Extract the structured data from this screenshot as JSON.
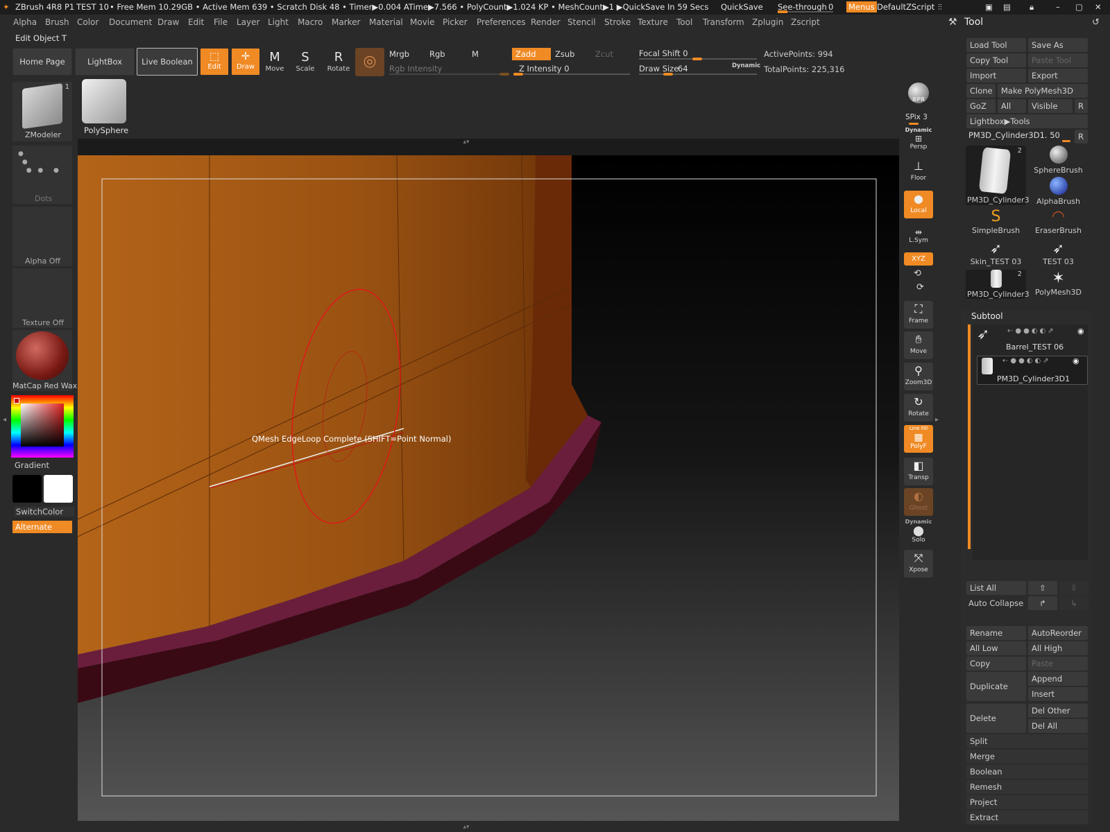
{
  "titlebar": {
    "app": "ZBrush 4R8 P1",
    "doc": "TEST 10",
    "stats": "• Free Mem 10.29GB • Active Mem 639 • Scratch Disk 48 • Timer▶0.004 ATime▶7.566 • PolyCount▶1.024 KP • MeshCount▶1 ▶QuickSave In 59 Secs",
    "quicksave": "QuickSave",
    "seethrough": "See-through",
    "seethrough_val": "0",
    "menus": "Menus",
    "defaultzscript": "DefaultZScript"
  },
  "menubar": [
    "Alpha",
    "Brush",
    "Color",
    "Document",
    "Draw",
    "Edit",
    "File",
    "Layer",
    "Light",
    "Macro",
    "Marker",
    "Material",
    "Movie",
    "Picker",
    "Preferences",
    "Render",
    "Stencil",
    "Stroke",
    "Texture",
    "Tool",
    "Transform",
    "Zplugin",
    "Zscript"
  ],
  "edit_object": "Edit Object T",
  "toolbar": {
    "home_page": "Home Page",
    "lightbox": "LightBox",
    "live_boolean": "Live Boolean",
    "edit": "Edit",
    "draw": "Draw",
    "move": "Move",
    "scale": "Scale",
    "rotate": "Rotate",
    "mrgb": "Mrgb",
    "rgb": "Rgb",
    "m": "M",
    "zadd": "Zadd",
    "zsub": "Zsub",
    "zcut": "Zcut",
    "rgb_intensity": "Rgb Intensity",
    "z_intensity": "Z Intensity 0",
    "focal_shift": "Focal Shift 0",
    "draw_size": "Draw Size",
    "draw_size_val": "64",
    "dynamic": "Dynamic",
    "active_points": "ActivePoints: 994",
    "total_points": "TotalPoints: 225,316"
  },
  "left": {
    "zmodeler": "ZModeler",
    "zmodeler_count": "1",
    "polysphere": "PolySphere",
    "dots": "Dots",
    "alpha_off": "Alpha Off",
    "texture_off": "Texture Off",
    "matcap": "MatCap Red Wax",
    "gradient": "Gradient",
    "switchcolor": "SwitchColor",
    "alternate": "Alternate"
  },
  "viewport": {
    "hint": "QMesh EdgeLoop Complete (SHIFT=Point Normal)"
  },
  "vtools": {
    "bpr": "BPR",
    "spix": "SPix 3",
    "dynamic": "Dynamic",
    "persp": "Persp",
    "floor": "Floor",
    "local": "Local",
    "lsym": "L.Sym",
    "xyz": "XYZ",
    "frame": "Frame",
    "move": "Move",
    "zoom3d": "Zoom3D",
    "rotate": "Rotate",
    "linefill": "Line Fill",
    "polyf": "PolyF",
    "transp": "Transp",
    "ghost": "Ghost",
    "dynamic2": "Dynamic",
    "solo": "Solo",
    "xpose": "Xpose"
  },
  "tool_panel": {
    "title": "Tool",
    "load_tool": "Load Tool",
    "save_as": "Save As",
    "copy_tool": "Copy Tool",
    "paste_tool": "Paste Tool",
    "import": "Import",
    "export": "Export",
    "clone": "Clone",
    "make_polymesh": "Make PolyMesh3D",
    "goz": "GoZ",
    "all": "All",
    "visible": "Visible",
    "r": "R",
    "lightbox_tools": "Lightbox▶Tools",
    "current_tool": "PM3D_Cylinder3D1. 50",
    "r2": "R",
    "tools": [
      {
        "label": "PM3D_Cylinder3",
        "badge": "2"
      },
      {
        "label": "SphereBrush",
        "badge": ""
      },
      {
        "label": "AlphaBrush",
        "badge": ""
      },
      {
        "label": "SimpleBrush",
        "badge": ""
      },
      {
        "label": "EraserBrush",
        "badge": ""
      },
      {
        "label": "Skin_TEST 03",
        "badge": ""
      },
      {
        "label": "TEST 03",
        "badge": ""
      },
      {
        "label": "PM3D_Cylinder3",
        "badge": "2"
      },
      {
        "label": "PolyMesh3D",
        "badge": ""
      }
    ]
  },
  "subtool": {
    "title": "Subtool",
    "items": [
      "Barrel_TEST 06",
      "PM3D_Cylinder3D1"
    ],
    "list_all": "List All",
    "auto_collapse": "Auto Collapse",
    "rename": "Rename",
    "autoreorder": "AutoReorder",
    "all_low": "All Low",
    "all_high": "All High",
    "copy": "Copy",
    "paste": "Paste",
    "duplicate": "Duplicate",
    "append": "Append",
    "insert": "Insert",
    "delete": "Delete",
    "del_other": "Del Other",
    "del_all": "Del All",
    "split": "Split",
    "merge": "Merge",
    "boolean": "Boolean",
    "remesh": "Remesh",
    "project": "Project",
    "extract": "Extract"
  },
  "colors": {
    "accent": "#f08a24",
    "background": "#2a2a2a"
  }
}
